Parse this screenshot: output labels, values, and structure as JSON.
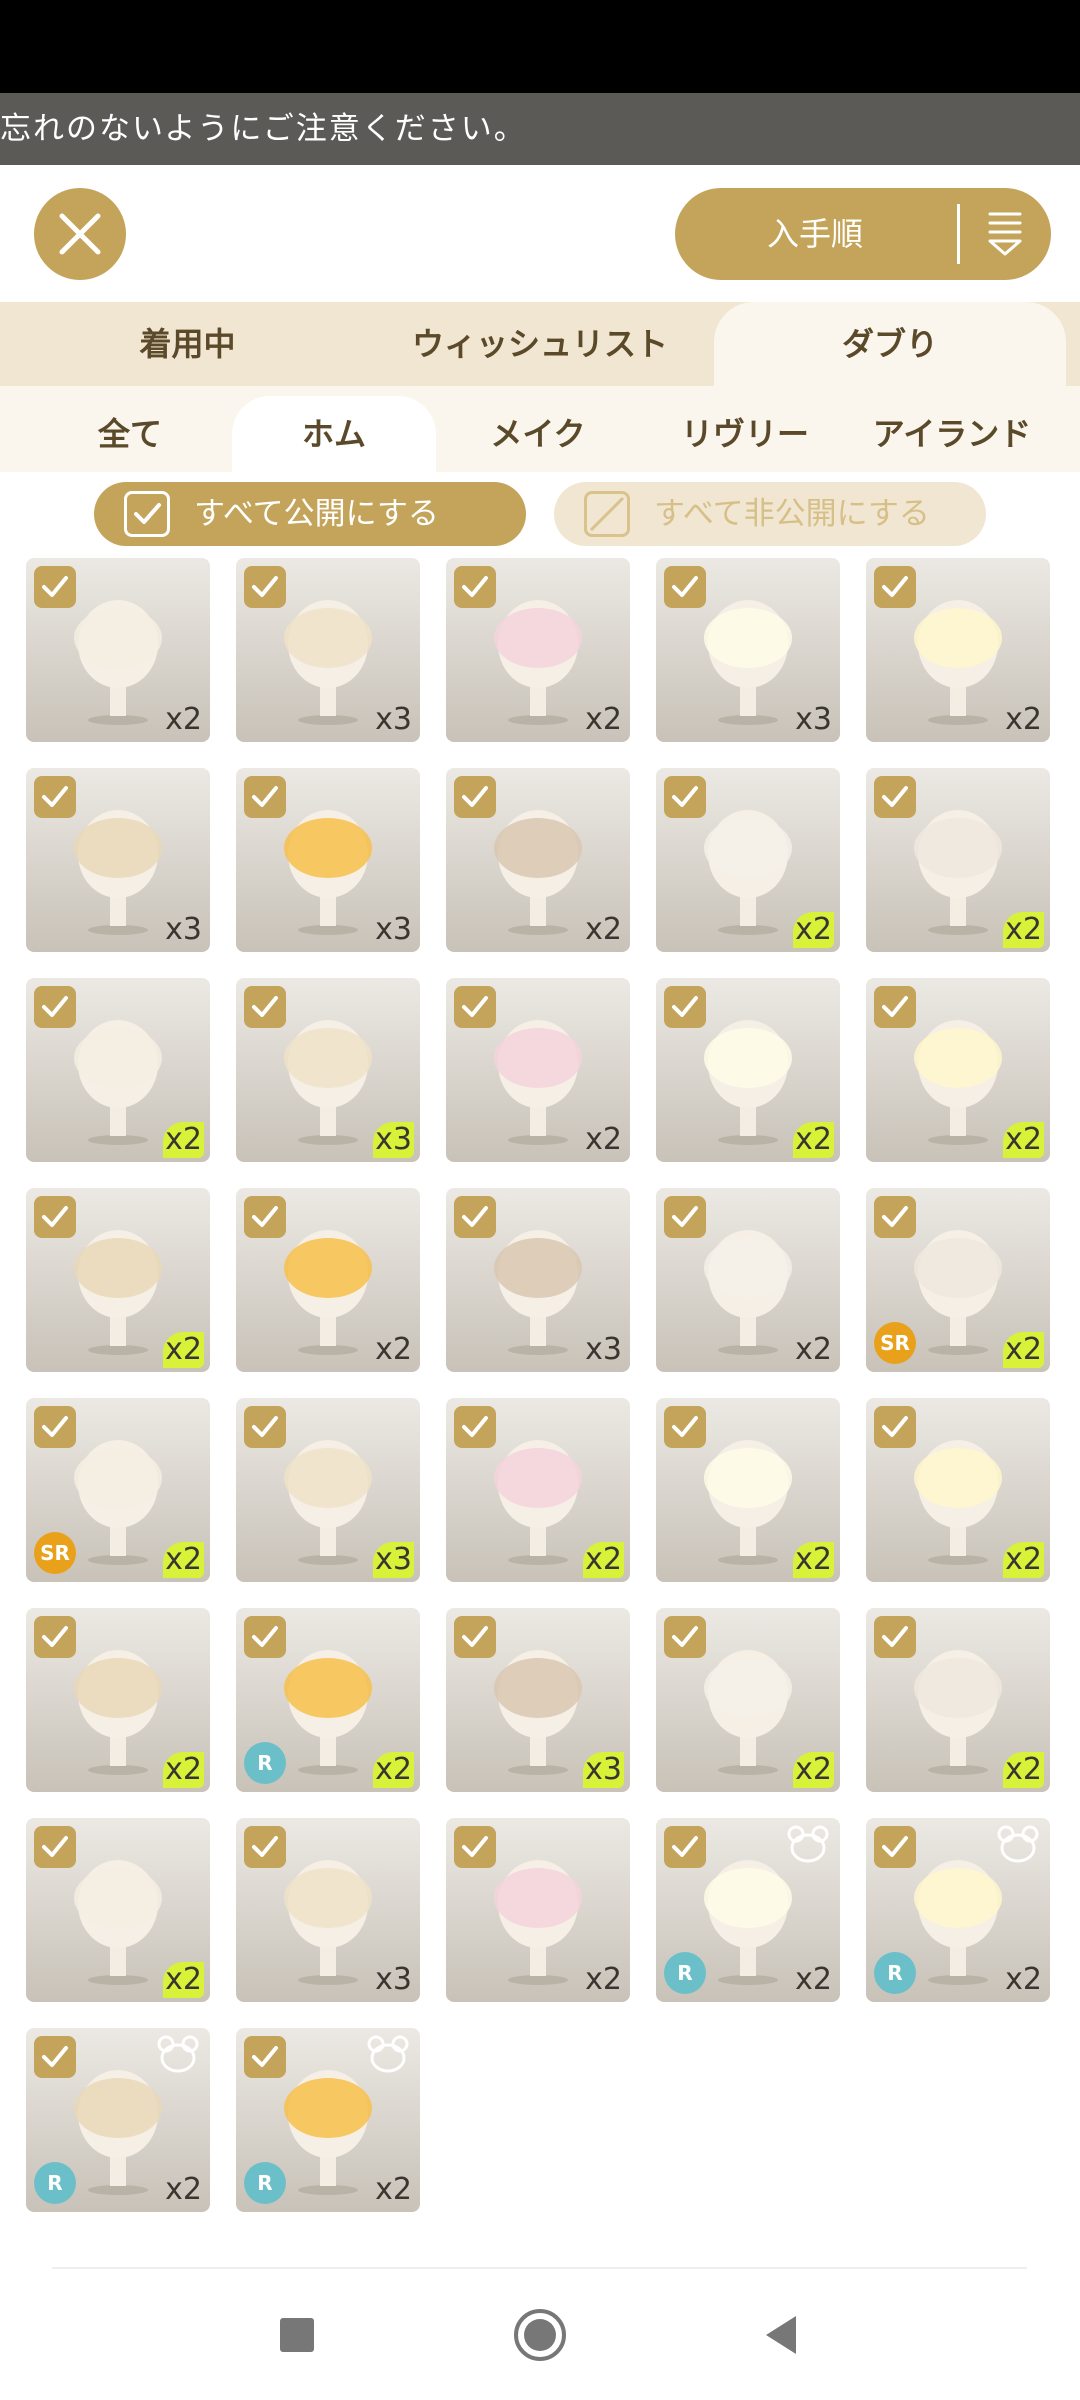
{
  "notice": {
    "text": "忘れのないようにご注意ください。"
  },
  "sort": {
    "label": "入手順"
  },
  "tabs": [
    {
      "label": "着用中"
    },
    {
      "label": "ウィッシュリスト"
    },
    {
      "label": "ダブり"
    }
  ],
  "subtabs": [
    {
      "label": "全て"
    },
    {
      "label": "ホム"
    },
    {
      "label": "メイク"
    },
    {
      "label": "リヴリー"
    },
    {
      "label": "アイランド"
    }
  ],
  "actions": {
    "publish_all": "すべて公開にする",
    "unpublish_all": "すべて非公開にする"
  },
  "items": [
    {
      "count": "x2",
      "icon": "black-headband-icon",
      "new": false
    },
    {
      "count": "x3",
      "icon": "easter-egg-antenna-icon",
      "new": false
    },
    {
      "count": "x2",
      "icon": "striped-sweater-icon",
      "new": false
    },
    {
      "count": "x3",
      "icon": "flower-outfit-icon",
      "new": false
    },
    {
      "count": "x2",
      "icon": "yellow-blouse-icon",
      "new": false
    },
    {
      "count": "x3",
      "icon": "flower-crown-icon",
      "new": false
    },
    {
      "count": "x3",
      "icon": "yellow-shorts-icon",
      "new": false
    },
    {
      "count": "x2",
      "icon": "bunny-hat-icon",
      "new": false
    },
    {
      "count": "x2",
      "icon": "white-top-icon",
      "new": true
    },
    {
      "count": "x2",
      "icon": "hair-strand-icon",
      "new": true
    },
    {
      "count": "x2",
      "icon": "green-goggles-icon",
      "new": true
    },
    {
      "count": "x3",
      "icon": "white-eyes-icon",
      "new": true
    },
    {
      "count": "x2",
      "icon": "pocket-watch-icon",
      "new": false
    },
    {
      "count": "x2",
      "icon": "plant-pot-costume-icon",
      "new": true
    },
    {
      "count": "x2",
      "icon": "muscle-tank-icon",
      "new": true
    },
    {
      "count": "x2",
      "icon": "blonde-hair-icon",
      "new": true
    },
    {
      "count": "x2",
      "icon": "witch-broom-icon",
      "new": false
    },
    {
      "count": "x3",
      "icon": "earring-icon",
      "new": false
    },
    {
      "count": "x2",
      "icon": "framed-poster-icon",
      "new": false
    },
    {
      "count": "x2",
      "icon": "tiger-mask-icon",
      "new": true,
      "rarity": "SR"
    },
    {
      "count": "x2",
      "icon": "chick-hat-icon",
      "new": true,
      "rarity": "SR"
    },
    {
      "count": "x3",
      "icon": "fluffy-creature-icon",
      "new": true
    },
    {
      "count": "x2",
      "icon": "printed-tshirt-icon",
      "new": true
    },
    {
      "count": "x2",
      "icon": "ground-effect-icon",
      "new": true
    },
    {
      "count": "x2",
      "icon": "flower-bouquet-icon",
      "new": true
    },
    {
      "count": "x2",
      "icon": "yellow-vest-icon",
      "new": true
    },
    {
      "count": "x2",
      "icon": "tiny-figure-card-icon",
      "new": true,
      "rarity": "R"
    },
    {
      "count": "x3",
      "icon": "sparkle-effect-icon",
      "new": true
    },
    {
      "count": "x2",
      "icon": "storm-cloud-icon",
      "new": true
    },
    {
      "count": "x2",
      "icon": "pink-slime-hair-icon",
      "new": true
    },
    {
      "count": "x2",
      "icon": "pink-curly-hair-icon",
      "new": true
    },
    {
      "count": "x3",
      "icon": "bear-hood-outfit-icon",
      "new": false
    },
    {
      "count": "x2",
      "icon": "white-sweater-icon",
      "new": false
    },
    {
      "count": "x2",
      "icon": "fluffy-tail-icon",
      "new": false,
      "rarity": "R",
      "bear": true
    },
    {
      "count": "x2",
      "icon": "brown-bob-hair-icon",
      "new": false,
      "rarity": "R",
      "bear": true
    },
    {
      "count": "x2",
      "icon": "bunny-ears-icon",
      "new": false,
      "rarity": "R",
      "bear": true
    },
    {
      "count": "x2",
      "icon": "long-brown-hair-icon",
      "new": false,
      "rarity": "R",
      "bear": true
    }
  ],
  "colors": {
    "accent": "#c4a45a",
    "new_badge": "#d8f23a",
    "sr": "#e9a11c",
    "r": "#6bbfc9"
  }
}
